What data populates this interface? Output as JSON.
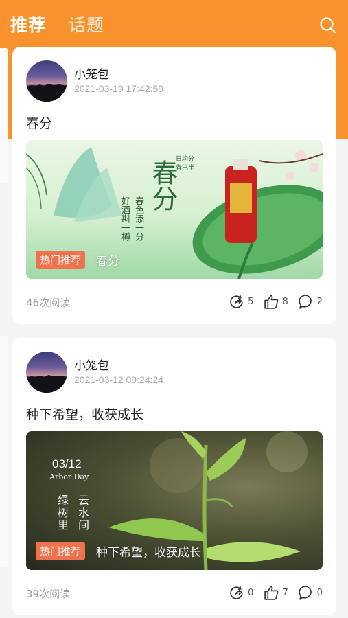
{
  "header": {
    "tabs": [
      {
        "label": "推荐",
        "active": true
      },
      {
        "label": "话题",
        "active": false
      }
    ]
  },
  "posts": [
    {
      "username": "小笼包",
      "datetime": "2021-03-19 17:42:59",
      "title": "春分",
      "tag": "热门推荐",
      "caption": "春分",
      "reads": "46次阅读",
      "shares": "5",
      "likes": "8",
      "comments": "2",
      "image_text": {
        "big": "春分",
        "col1": "春色添一分",
        "col2": "好酒斟一樽",
        "seal": "日均分 春已半"
      }
    },
    {
      "username": "小笼包",
      "datetime": "2021-03-12 09:24:24",
      "title": "种下希望，收获成长",
      "tag": "热门推荐",
      "caption": "种下希望，收获成长",
      "reads": "39次阅读",
      "shares": "0",
      "likes": "7",
      "comments": "0",
      "image_text": {
        "date": "03/12",
        "sub": "Arbor Day",
        "col1": "云水间",
        "col2": "绿树里"
      }
    }
  ],
  "colors": {
    "accent": "#f7922c",
    "tag": "#f0724d"
  }
}
